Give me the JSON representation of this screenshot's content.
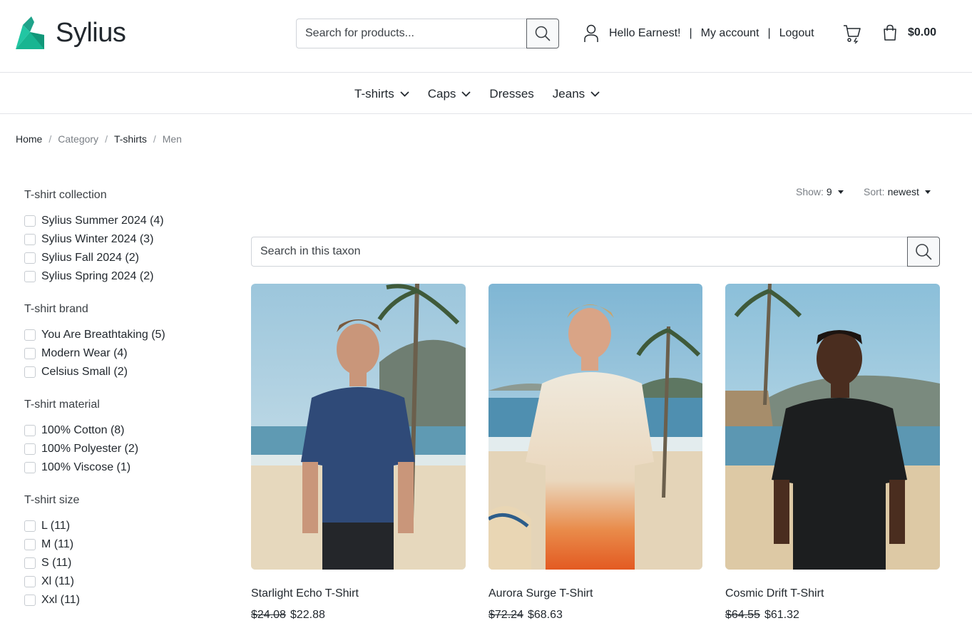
{
  "header": {
    "brand": "Sylius",
    "search_placeholder": "Search for products...",
    "greeting": "Hello Earnest!",
    "my_account": "My account",
    "logout": "Logout",
    "separator": "|",
    "cart_total": "$0.00"
  },
  "nav": {
    "items": [
      {
        "label": "T-shirts",
        "has_dropdown": true
      },
      {
        "label": "Caps",
        "has_dropdown": true
      },
      {
        "label": "Dresses",
        "has_dropdown": false
      },
      {
        "label": "Jeans",
        "has_dropdown": true
      }
    ]
  },
  "breadcrumb": {
    "items": [
      "Home",
      "Category",
      "T-shirts",
      "Men"
    ],
    "separator": "/"
  },
  "filters": {
    "groups": [
      {
        "title": "T-shirt collection",
        "options": [
          "Sylius Summer 2024 (4)",
          "Sylius Winter 2024 (3)",
          "Sylius Fall 2024 (2)",
          "Sylius Spring 2024 (2)"
        ]
      },
      {
        "title": "T-shirt brand",
        "options": [
          "You Are Breathtaking (5)",
          "Modern Wear (4)",
          "Celsius Small (2)"
        ]
      },
      {
        "title": "T-shirt material",
        "options": [
          "100% Cotton (8)",
          "100% Polyester (2)",
          "100% Viscose (1)"
        ]
      },
      {
        "title": "T-shirt size",
        "options": [
          "L (11)",
          "M (11)",
          "S (11)",
          "Xl (11)",
          "Xxl (11)"
        ]
      }
    ]
  },
  "toolbar": {
    "show_label": "Show:",
    "show_value": "9",
    "sort_label": "Sort:",
    "sort_value": "newest"
  },
  "taxon_search": {
    "placeholder": "Search in this taxon"
  },
  "products": [
    {
      "name": "Starlight Echo T-Shirt",
      "old_price": "$24.08",
      "price": "$22.88",
      "shirt_color": "#2f4a78"
    },
    {
      "name": "Aurora Surge T-Shirt",
      "old_price": "$72.24",
      "price": "$68.63",
      "shirt_color": "#e8e2d2"
    },
    {
      "name": "Cosmic Drift T-Shirt",
      "old_price": "$64.55",
      "price": "$61.32",
      "shirt_color": "#1c1e1f"
    }
  ],
  "colors": {
    "brand_teal": "#1abb9c",
    "text": "#22282e",
    "muted": "#7a7f85",
    "border": "#e2e4e8"
  }
}
